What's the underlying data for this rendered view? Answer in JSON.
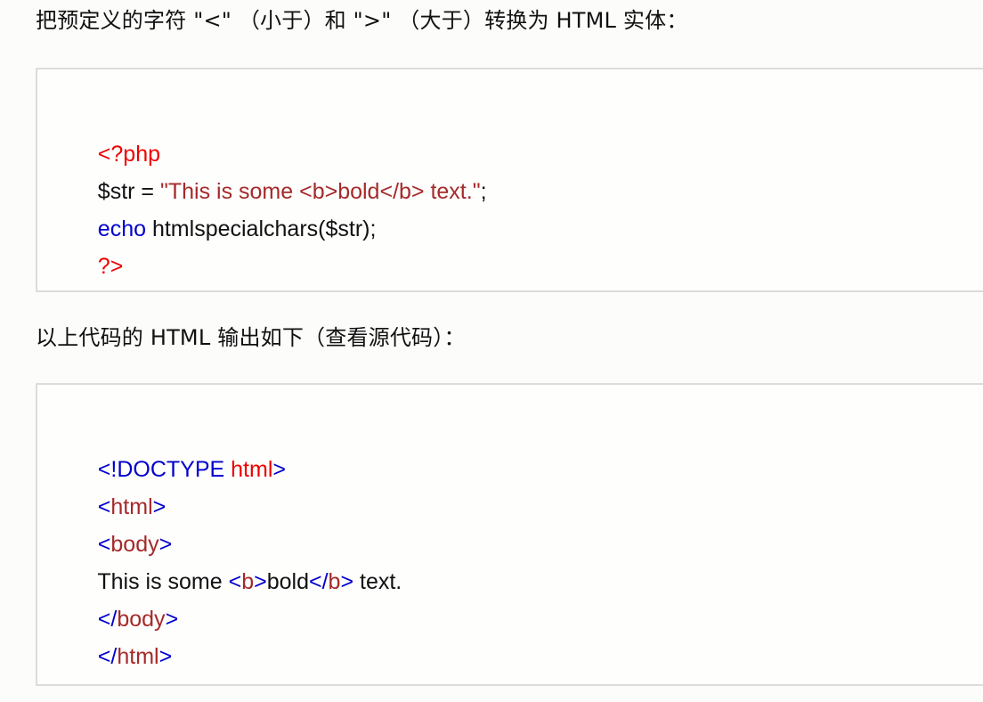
{
  "intro_text": "把预定义的字符 \"<\" （小于）和 \">\" （大于）转换为 HTML 实体：",
  "output_text": "以上代码的 HTML 输出如下（查看源代码）：",
  "php_code": {
    "line1_open": "<?php",
    "line2_var": "$str = ",
    "line2_string": "\"This is some <b>bold</b> text.\"",
    "line2_end": ";",
    "line3_keyword": "echo",
    "line3_rest": " htmlspecialchars($str);",
    "line4_close": "?>"
  },
  "html_output": {
    "doctype_open": "<!DOCTYPE ",
    "doctype_word": "html",
    "doctype_close": ">",
    "html_lt": "<",
    "html_tag": "html",
    "html_gt": ">",
    "body_lt": "<",
    "body_tag": "body",
    "body_gt": ">",
    "text_start": "This is some ",
    "b_lt": "<",
    "b_tag": "b",
    "b_gt": ">",
    "b_content": "bold",
    "b_end_lt": "</",
    "b_end_tag": "b",
    "b_end_gt": ">",
    "text_end": " text.",
    "body_end_lt": "</",
    "body_end_tag": "body",
    "body_end_gt": ">",
    "html_end_lt": "</",
    "html_end_tag": "html",
    "html_end_gt": ">"
  },
  "colors": {
    "php_tag": "#ee0000",
    "string": "#a52a2a",
    "keyword": "#0000cd",
    "html_tag_name": "#a52a2a",
    "html_bracket": "#0000cd"
  }
}
